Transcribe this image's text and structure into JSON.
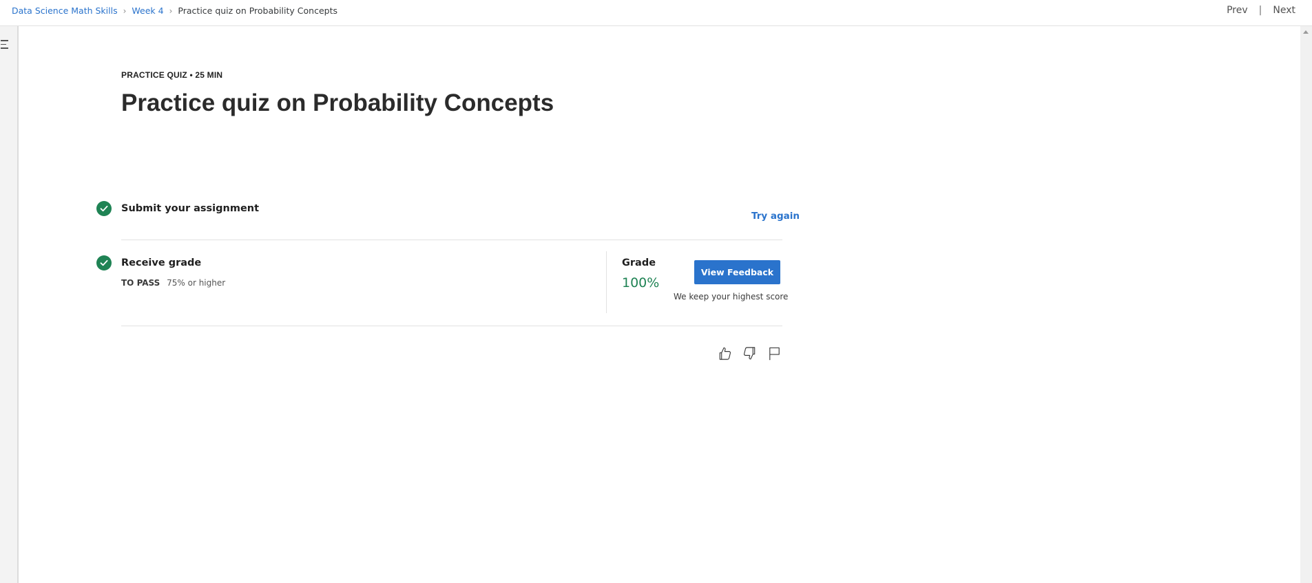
{
  "breadcrumb": {
    "course": "Data Science Math Skills",
    "week": "Week 4",
    "current": "Practice quiz on Probability Concepts",
    "separator": "›"
  },
  "topnav": {
    "prev": "Prev",
    "separator": "|",
    "next": "Next"
  },
  "header": {
    "eyebrow": "PRACTICE QUIZ • 25 MIN",
    "title": "Practice quiz on Probability Concepts"
  },
  "submit_step": {
    "title": "Submit your assignment",
    "action_label": "Try again",
    "completed": true
  },
  "grade_step": {
    "title": "Receive grade",
    "pass_label": "TO PASS",
    "pass_requirement": "75% or higher",
    "grade_label": "Grade",
    "grade_value": "100%",
    "button_label": "View Feedback",
    "note": "We keep your highest score",
    "completed": true
  },
  "icons": {
    "menu": "menu-icon",
    "check": "check-circle-icon",
    "like": "thumbs-up-icon",
    "dislike": "thumbs-down-icon",
    "report": "flag-icon"
  },
  "colors": {
    "accent": "#2a73cc",
    "success": "#1f8354",
    "text": "#1f1f1f"
  }
}
